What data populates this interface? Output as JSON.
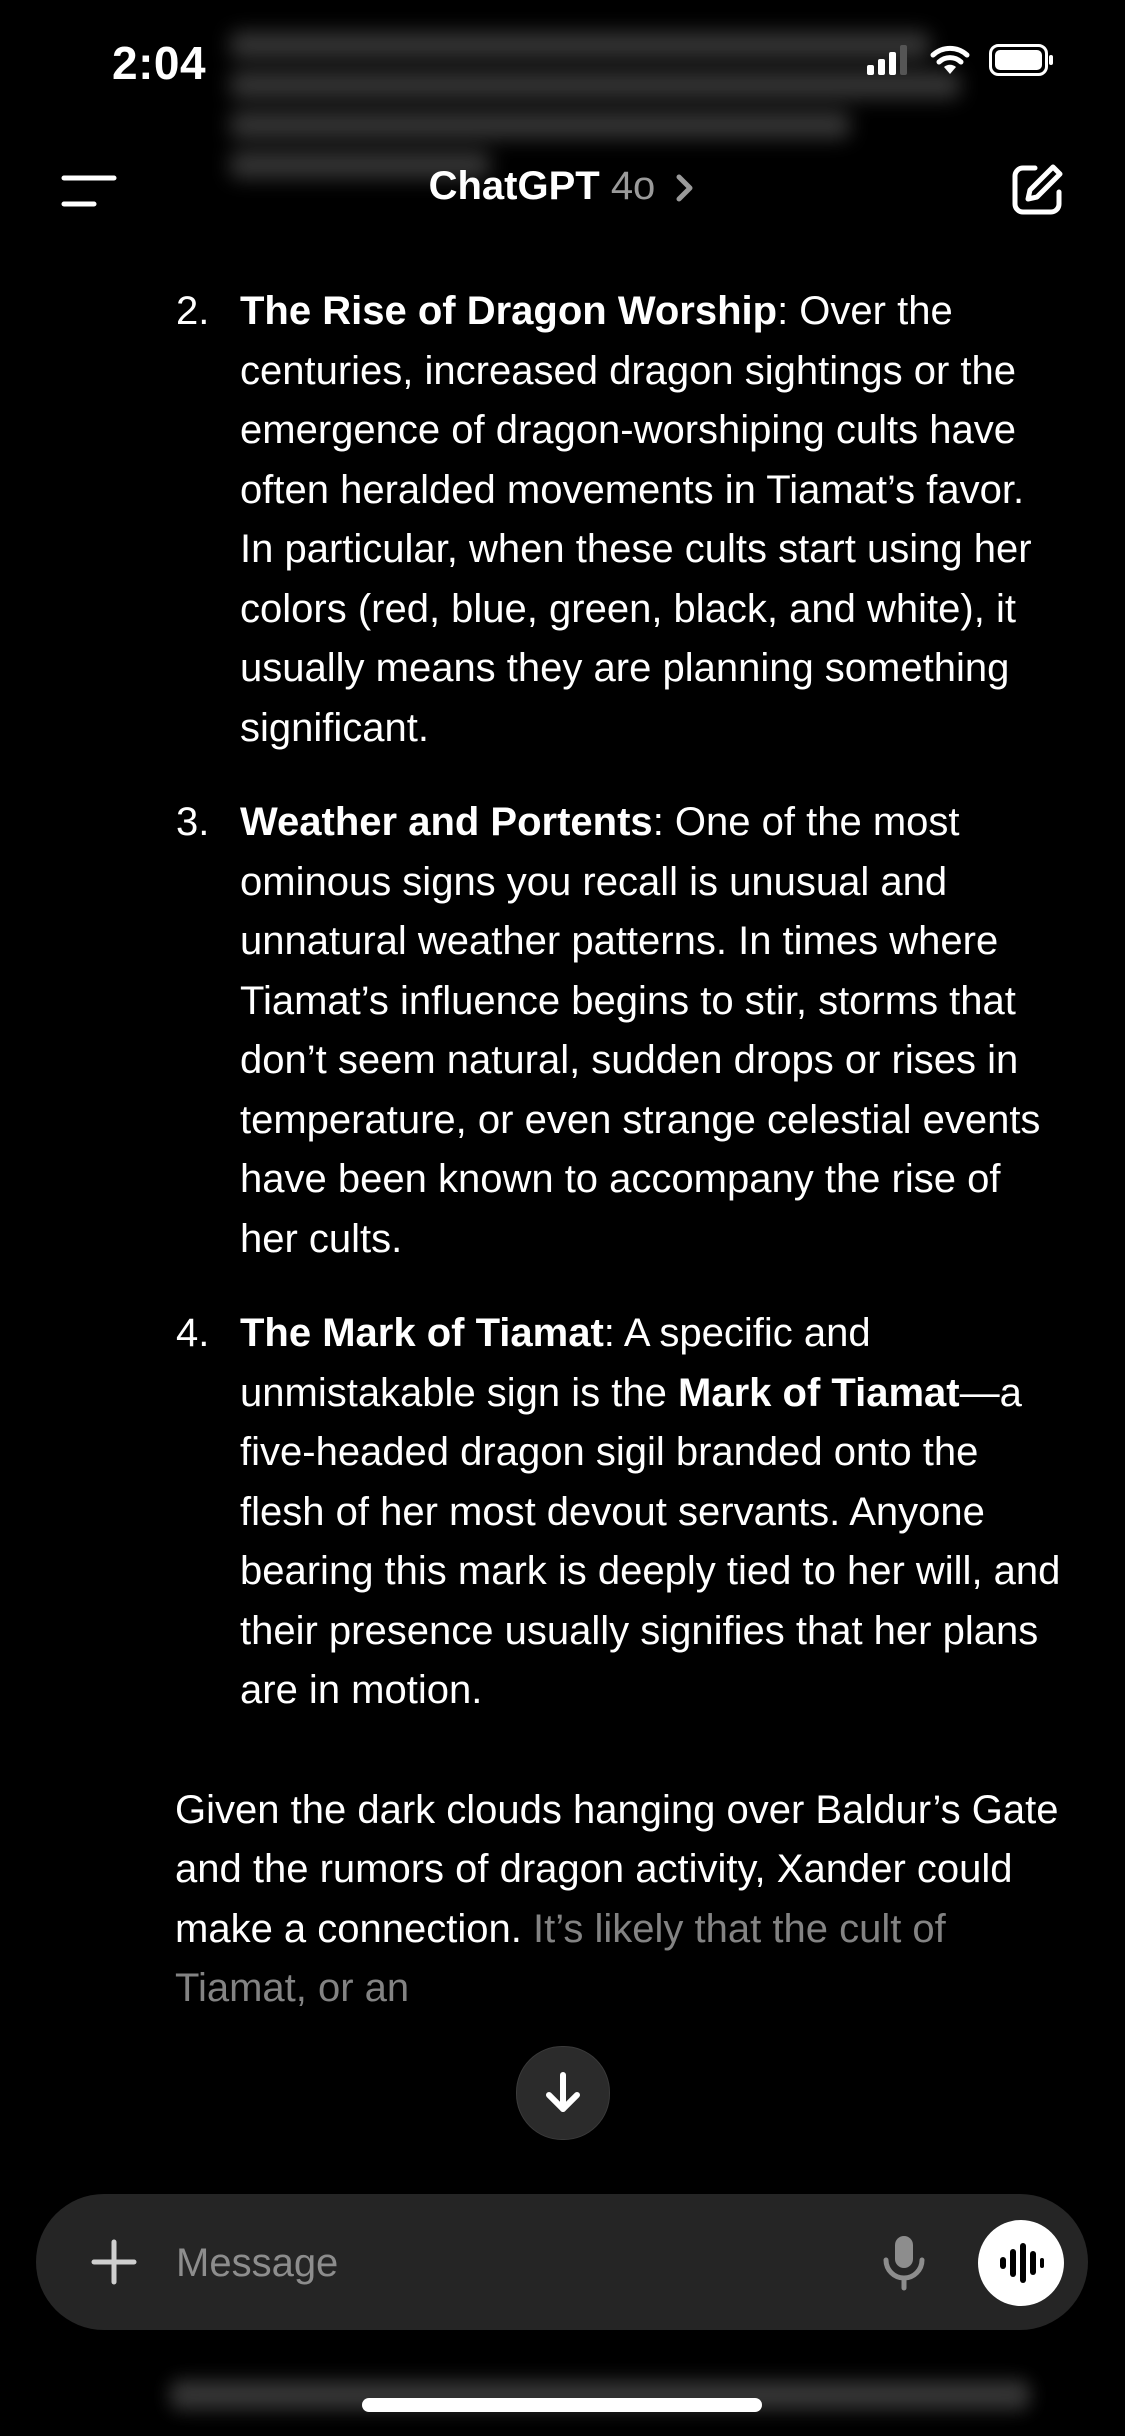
{
  "status_bar": {
    "time": "2:04"
  },
  "nav": {
    "title": "ChatGPT",
    "model": "4o"
  },
  "items": [
    {
      "number": "2.",
      "heading": "The Rise of Dragon Worship",
      "text": ": Over the centuries, increased dragon sightings or the emergence of dragon-worshiping cults have often heralded movements in Tiamat’s favor. In particular, when these cults start using her colors (red, blue, green, black, and white), it usually means they are planning something significant."
    },
    {
      "number": "3.",
      "heading": "Weather and Portents",
      "text": ": One of the most ominous signs you recall is unusual and unnatural weather patterns. In times where Tiamat’s influence begins to stir, storms that don’t seem natural, sudden drops or rises in temperature, or even strange celestial events have been known to accompany the rise of her cults."
    },
    {
      "number": "4.",
      "heading": "The Mark of Tiamat",
      "text_1": ": A specific and unmistakable sign is the ",
      "bold_inline": "Mark of Tiamat",
      "text_2": "—a five-headed dragon sigil branded onto the flesh of her most devout servants. Anyone bearing this mark is deeply tied to her will, and their presence usually signifies that her plans are in motion."
    }
  ],
  "closing_paragraph": {
    "text": "Given the dark clouds hanging over Baldur’s Gate and the rumors of dragon activity, Xander could make a connection.",
    "faded_text": "It’s likely that the cult of Tiamat, or an"
  },
  "composer": {
    "placeholder": "Message"
  },
  "icons": {
    "menu": "menu-icon",
    "edit": "new-chat-icon",
    "scroll": "arrow-down-icon",
    "plus": "plus-icon",
    "mic": "microphone-icon",
    "voice": "voice-waveform-icon"
  }
}
